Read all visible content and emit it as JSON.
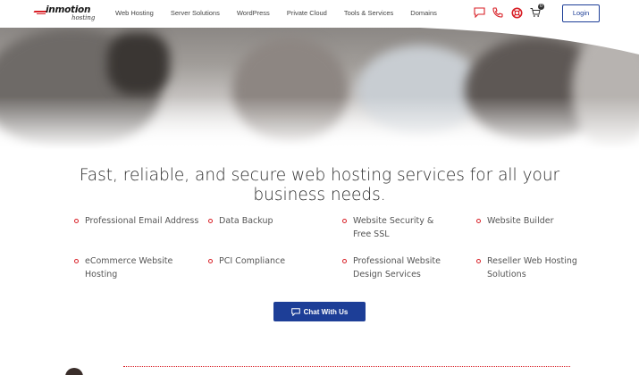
{
  "header": {
    "logo": {
      "brand": "inmotion",
      "sub": "hosting"
    },
    "nav": [
      "Web Hosting",
      "Server Solutions",
      "WordPress",
      "Private Cloud",
      "Tools & Services",
      "Domains"
    ],
    "icons": [
      "chat-icon",
      "phone-icon",
      "support-lifebuoy-icon",
      "cart-icon"
    ],
    "cart_count": "0",
    "login_label": "Login"
  },
  "main": {
    "headline": "Fast, reliable, and secure web hosting services for all your business needs.",
    "features": [
      "Professional Email Address",
      "Data Backup",
      "Website Security & Free SSL",
      "Website Builder",
      "eCommerce Website Hosting",
      "PCI Compliance",
      "Professional Website Design Services",
      "Reseller Web Hosting Solutions"
    ],
    "chat_label": "Chat With Us"
  },
  "colors": {
    "accent_red": "#d81f26",
    "brand_blue": "#1d3e97"
  }
}
